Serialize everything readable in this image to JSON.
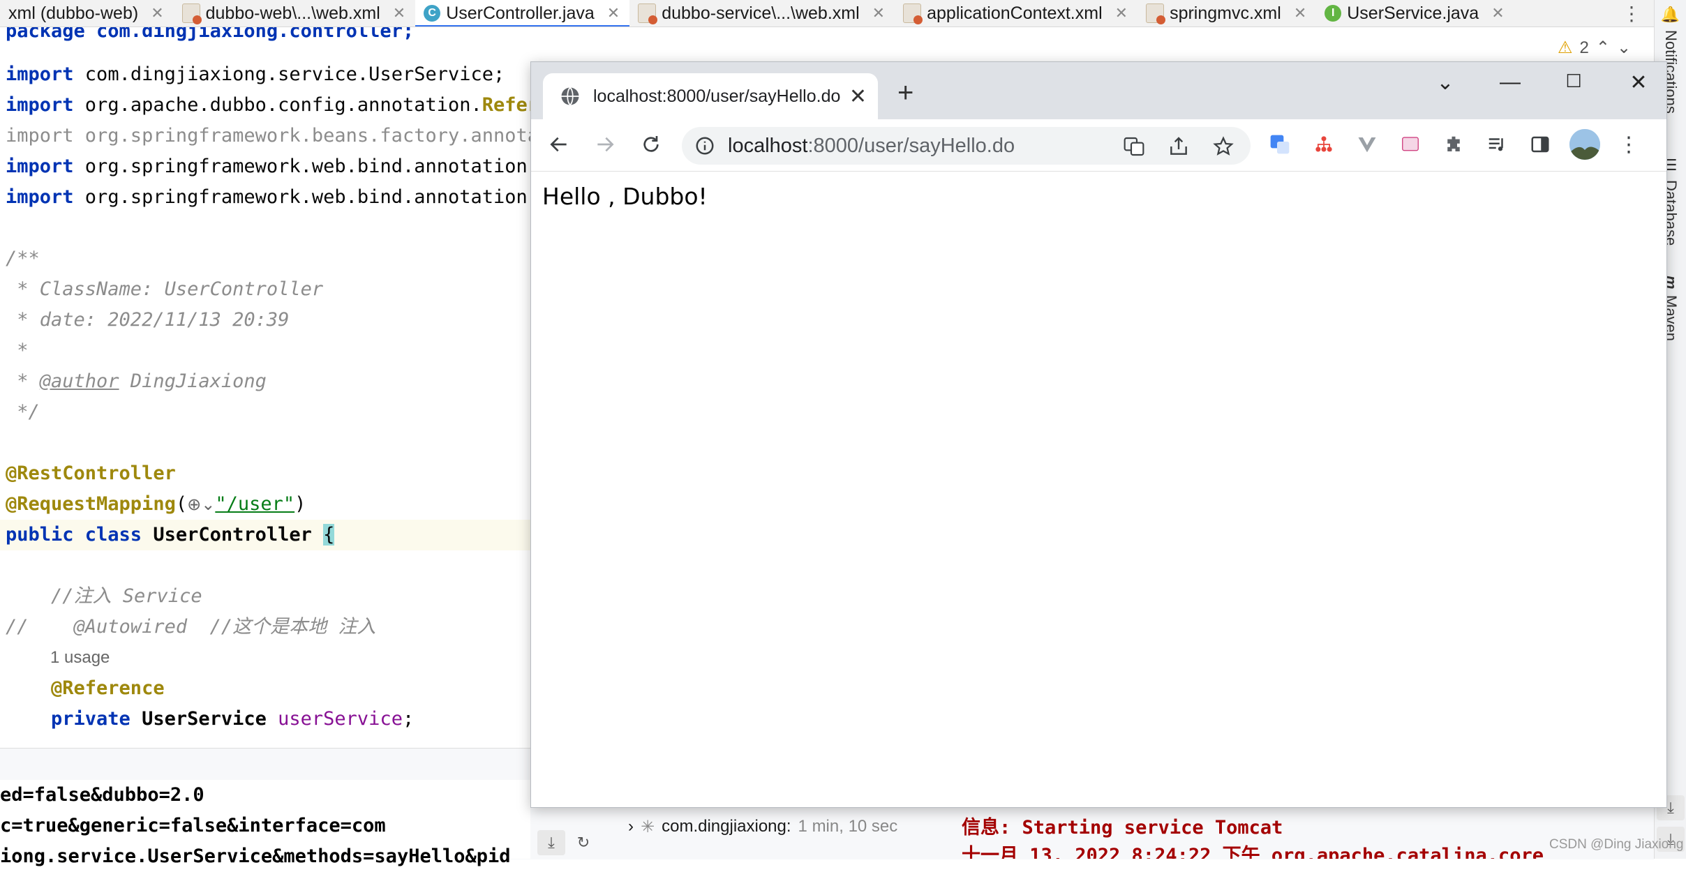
{
  "ide": {
    "tabs": [
      {
        "label": "xml (dubbo-web)",
        "icon": "xml-file-icon",
        "active": false
      },
      {
        "label": "dubbo-web\\...\\web.xml",
        "icon": "xml-file-icon",
        "active": false
      },
      {
        "label": "UserController.java",
        "icon": "class-icon",
        "active": true
      },
      {
        "label": "dubbo-service\\...\\web.xml",
        "icon": "xml-file-icon",
        "active": false
      },
      {
        "label": "applicationContext.xml",
        "icon": "xml-file-icon",
        "active": false
      },
      {
        "label": "springmvc.xml",
        "icon": "xml-file-icon",
        "active": false
      },
      {
        "label": "UserService.java",
        "icon": "interface-icon",
        "active": false
      }
    ],
    "tab_class_letter": "C",
    "tab_iface_letter": "I",
    "warnings_count": "2",
    "code": {
      "l1": "package com.dingjiaxiong.controller;",
      "l3_kw": "import",
      "l3": " com.dingjiaxiong.service.UserService;",
      "l4_kw": "import",
      "l4": " org.apache.dubbo.config.annotation.",
      "l4_ann": "Refer",
      "l5": "import org.springframework.beans.factory.annota",
      "l6_kw": "import",
      "l6": " org.springframework.web.bind.annotation.",
      "l7_kw": "import",
      "l7": " org.springframework.web.bind.annotation.",
      "l9": "/**",
      "l10": " * ClassName: UserController",
      "l11": " * date: 2022/11/13 20:39",
      "l12": " *",
      "l13_pre": " * ",
      "l13_tag": "@author",
      "l13_post": " DingJiaxiong",
      "l14": " */",
      "l16": "@RestController",
      "l17_ann": "@RequestMapping",
      "l17_open": "(",
      "l17_str": "\"/user\"",
      "l17_close": ")",
      "l18_kw": "public class",
      "l18": " UserController ",
      "l18_brace": "{",
      "l20_cmt": "    //注入 Service",
      "l21_cmt": "//    @Autowired  //这个是本地 注入",
      "l22_hint": "1 usage",
      "l23_ann": "    @Reference",
      "l24_kw": "    private",
      "l24": " UserService ",
      "l24_field": "userService",
      "l24_end": ";"
    },
    "console_left": [
      "ed=false&dubbo=2.0",
      "c=true&generic=false&interface=com",
      "iong.service.UserService&methods=sayHello&pid"
    ],
    "run_tree": {
      "label": "com.dingjiaxiong:",
      "time": "1 min, 10 sec"
    },
    "console_right": [
      "信息: Starting service Tomcat",
      "十一月 13, 2022 8:24:22 下午 org.apache.catalina.core"
    ],
    "right_strip": [
      "Notifications",
      "Database",
      "Maven"
    ]
  },
  "browser": {
    "tab_title": "localhost:8000/user/sayHello.do",
    "url_host": "localhost",
    "url_path": ":8000/user/sayHello.do",
    "page_text": "Hello , Dubbo!"
  },
  "watermark": "CSDN @Ding Jiaxiong",
  "colors": {
    "accent": "#3574f0",
    "keyword": "#0033b3",
    "annotation": "#9e880d",
    "string": "#067d17",
    "comment": "#8c8c8c"
  }
}
